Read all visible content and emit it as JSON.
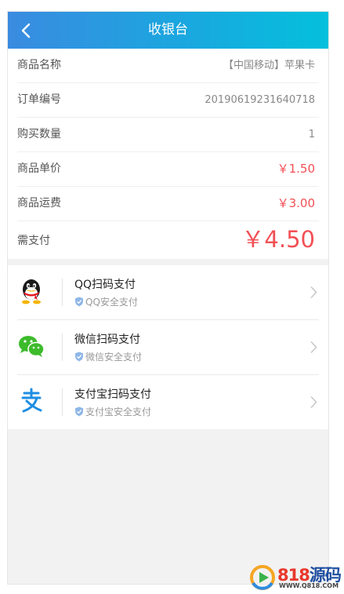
{
  "header": {
    "title": "收银台"
  },
  "order": [
    {
      "label": "商品名称",
      "value": "【中国移动】苹果卡"
    },
    {
      "label": "订单编号",
      "value": "20190619231640718"
    },
    {
      "label": "购买数量",
      "value": "1"
    },
    {
      "label": "商品单价",
      "value": "￥1.50"
    },
    {
      "label": "商品运费",
      "value": "￥3.00"
    }
  ],
  "total": {
    "label": "需支付",
    "value": "￥4.50"
  },
  "payments": [
    {
      "name": "QQ扫码支付",
      "sub": "QQ安全支付",
      "icon": "qq-icon"
    },
    {
      "name": "微信扫码支付",
      "sub": "微信安全支付",
      "icon": "wechat-icon"
    },
    {
      "name": "支付宝扫码支付",
      "sub": "支付宝安全支付",
      "icon": "alipay-icon"
    }
  ],
  "watermark": {
    "brand_num": "818",
    "brand_text": "源码",
    "url": "WWW.Q818.COM"
  },
  "colors": {
    "header_start": "#3a8be0",
    "header_end": "#04c0dc",
    "price": "#f25056"
  }
}
